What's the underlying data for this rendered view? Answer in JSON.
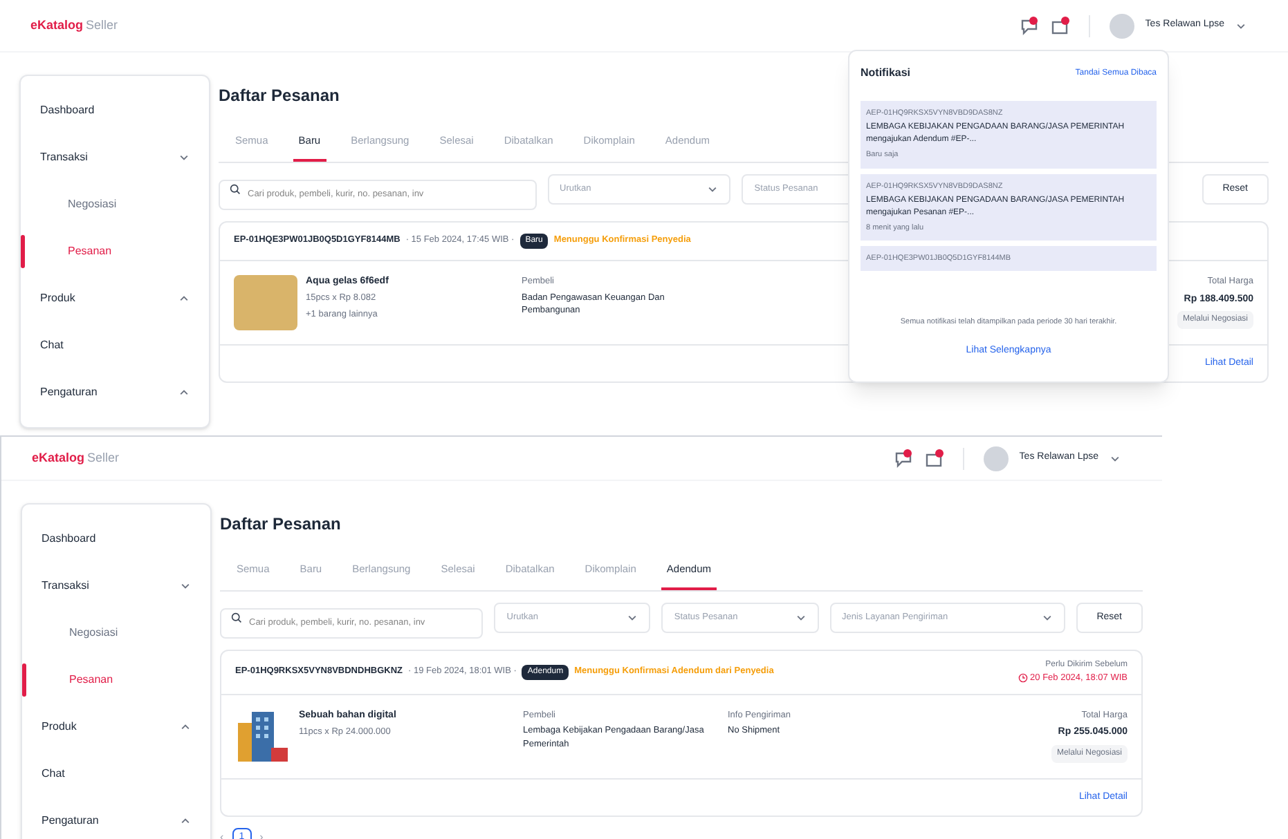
{
  "screens": [
    {
      "header": {
        "logo_brand": "eKatalog",
        "logo_suffix": "Seller",
        "user_name": "Tes Relawan Lpse"
      },
      "sidebar": [
        {
          "label": "Dashboard",
          "selected": false
        },
        {
          "label": "Transaksi",
          "selected": false,
          "expanded": true,
          "children": [
            {
              "label": "Negosiasi",
              "selected": false
            },
            {
              "label": "Pesanan",
              "selected": true
            }
          ]
        },
        {
          "label": "Produk",
          "selected": false,
          "expanded": false
        },
        {
          "label": "Chat",
          "selected": false
        },
        {
          "label": "Pengaturan",
          "selected": false,
          "expanded": false
        }
      ],
      "page_title": "Daftar Pesanan",
      "tabs": [
        {
          "label": "Semua",
          "selected": false
        },
        {
          "label": "Baru",
          "selected": true
        },
        {
          "label": "Berlangsung",
          "selected": false
        },
        {
          "label": "Selesai",
          "selected": false
        },
        {
          "label": "Dibatalkan",
          "selected": false
        },
        {
          "label": "Dikomplain",
          "selected": false
        },
        {
          "label": "Adendum",
          "selected": false
        }
      ],
      "search": {
        "placeholder": "Cari produk, pembeli, kurir, no. pesanan, inv"
      },
      "filters": [
        {
          "placeholder": "Urutkan"
        },
        {
          "placeholder": "Status Pesanan"
        }
      ],
      "reset": "Reset",
      "order": {
        "id": "EP-01HQE3PW01JB0Q5D1GYF8144MB",
        "date": "· 15 Feb 2024, 17:45 WIB ·",
        "badge": "Baru",
        "status": "Menunggu Konfirmasi Penyedia",
        "name": "Aqua gelas 6f6edf",
        "qty": "15pcs x Rp 8.082",
        "more": "+1 barang lainnya",
        "buyer_label": "Pembeli",
        "buyer": "Badan Pengawasan Keuangan Dan Pembangunan",
        "total_label": "Total Harga",
        "total": "Rp 188.409.500",
        "method": "Melalui Negosiasi",
        "detail": "Lihat Detail"
      },
      "notifications": {
        "title": "Notifikasi",
        "mark_all": "Tandai Semua Dibaca",
        "items": [
          {
            "ref": "AEP-01HQ9RKSX5VYN8VBD9DAS8NZ",
            "text": "LEMBAGA KEBIJAKAN PENGADAAN BARANG/JASA PEMERINTAH mengajukan Adendum #EP-...",
            "time": "Baru saja"
          },
          {
            "ref": "AEP-01HQ9RKSX5VYN8VBD9DAS8NZ",
            "text": "LEMBAGA KEBIJAKAN PENGADAAN BARANG/JASA PEMERINTAH mengajukan Pesanan #EP-...",
            "time": "8 menit yang lalu"
          },
          {
            "ref": "AEP-01HQE3PW01JB0Q5D1GYF8144MB"
          }
        ],
        "footer": "Semua notifikasi telah ditampilkan pada periode 30 hari terakhir.",
        "more": "Lihat Selengkapnya"
      }
    },
    {
      "header": {
        "logo_brand": "eKatalog",
        "logo_suffix": "Seller",
        "user_name": "Tes Relawan Lpse"
      },
      "sidebar": [
        {
          "label": "Dashboard",
          "selected": false
        },
        {
          "label": "Transaksi",
          "selected": false,
          "expanded": true,
          "children": [
            {
              "label": "Negosiasi",
              "selected": false
            },
            {
              "label": "Pesanan",
              "selected": true
            }
          ]
        },
        {
          "label": "Produk",
          "selected": false,
          "expanded": false
        },
        {
          "label": "Chat",
          "selected": false
        },
        {
          "label": "Pengaturan",
          "selected": false,
          "expanded": false
        }
      ],
      "page_title": "Daftar Pesanan",
      "tabs": [
        {
          "label": "Semua",
          "selected": false
        },
        {
          "label": "Baru",
          "selected": false
        },
        {
          "label": "Berlangsung",
          "selected": false
        },
        {
          "label": "Selesai",
          "selected": false
        },
        {
          "label": "Dibatalkan",
          "selected": false
        },
        {
          "label": "Dikomplain",
          "selected": false
        },
        {
          "label": "Adendum",
          "selected": true
        }
      ],
      "search": {
        "placeholder": "Cari produk, pembeli, kurir, no. pesanan, inv"
      },
      "filters": [
        {
          "placeholder": "Urutkan"
        },
        {
          "placeholder": "Status Pesanan"
        },
        {
          "placeholder": "Jenis Layanan Pengiriman"
        }
      ],
      "reset": "Reset",
      "order": {
        "id": "EP-01HQ9RKSX5VYN8VBDNDHBGKNZ",
        "date": "· 19 Feb 2024, 18:01 WIB ·",
        "badge": "Adendum",
        "status": "Menunggu Konfirmasi Adendum dari Penyedia",
        "deadline_label": "Perlu Dikirim Sebelum",
        "deadline": "20 Feb 2024, 18:07 WIB",
        "name": "Sebuah bahan digital",
        "qty": "11pcs x Rp 24.000.000",
        "buyer_label": "Pembeli",
        "buyer": "Lembaga Kebijakan Pengadaan Barang/Jasa Pemerintah",
        "shipping_label": "Info Pengiriman",
        "shipping": "No Shipment",
        "total_label": "Total Harga",
        "total": "Rp 255.045.000",
        "method": "Melalui Negosiasi",
        "detail": "Lihat Detail"
      },
      "pagination": {
        "prev": "‹",
        "pages": [
          {
            "label": "1",
            "selected": true
          }
        ],
        "next": "›"
      }
    }
  ]
}
